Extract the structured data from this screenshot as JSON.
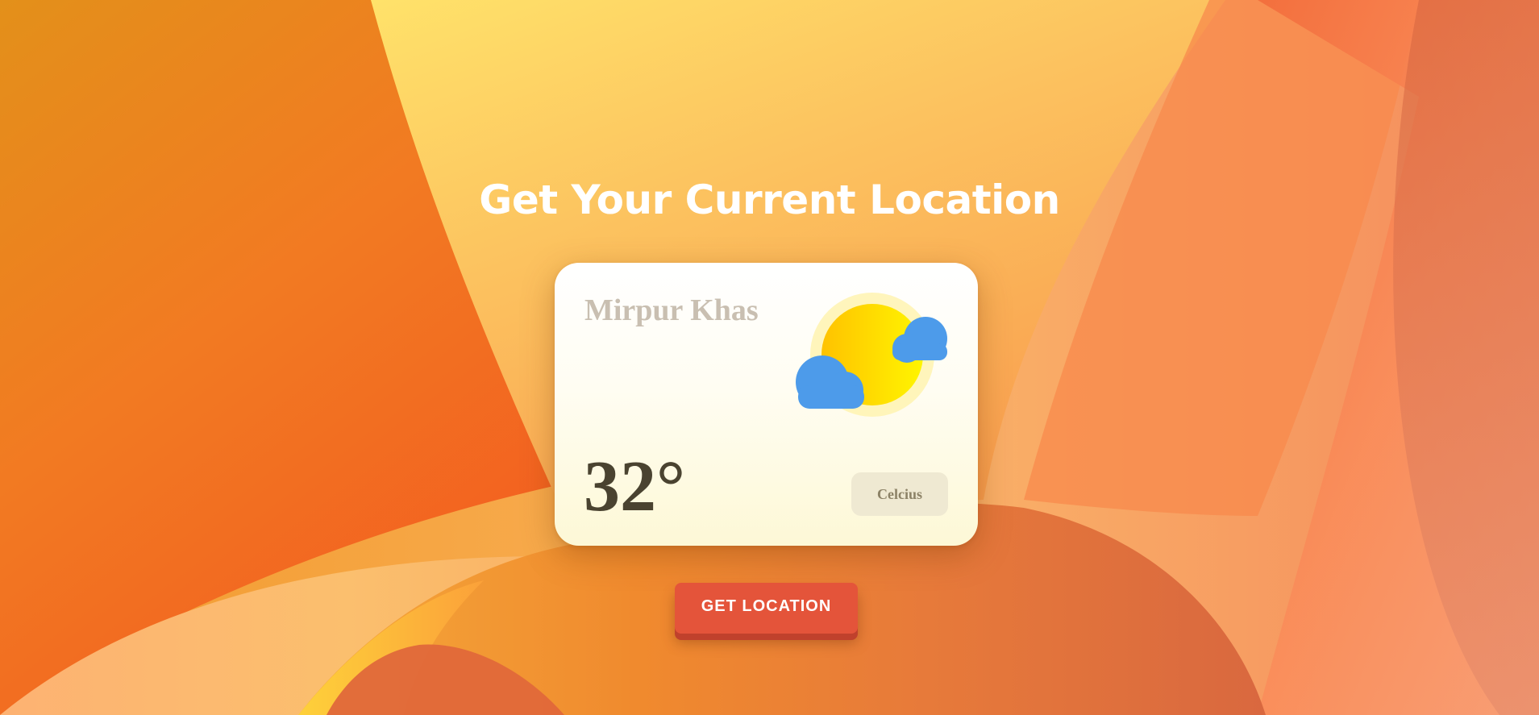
{
  "page": {
    "heading": "Get Your Current Location"
  },
  "weather_card": {
    "city": "Mirpur Khas",
    "temperature": "32°",
    "unit_button_label": "Celcius",
    "icon": "sun-with-clouds-icon"
  },
  "actions": {
    "get_location_label": "GET LOCATION"
  },
  "colors": {
    "button_accent": "#e4543a",
    "cloud": "#4d9bea",
    "sun": "#ffd400",
    "card_background": "#fffdf2"
  }
}
